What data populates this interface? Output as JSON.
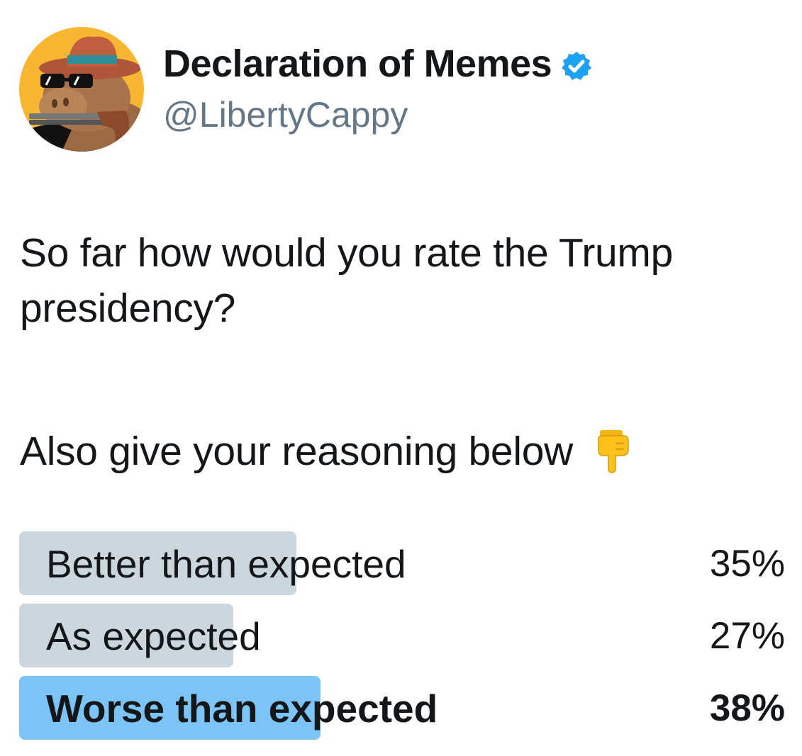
{
  "author": {
    "display_name": "Declaration of Memes",
    "handle": "@LibertyCappy",
    "verified": true,
    "avatar_icon": "capybara-cowboy-avatar",
    "verified_icon": "verified-badge-icon",
    "verified_color": "#1da1f2"
  },
  "tweet": {
    "line1": "So far how would you rate the Trump presidency?",
    "line2": "Also give your reasoning below",
    "emoji_icon": "backhand-index-pointing-down-icon"
  },
  "poll": {
    "bar_color": "#ccd6dd",
    "winner_color": "#7cc3f6",
    "options": [
      {
        "label": "Better than expected",
        "percent": "35%",
        "fraction": 0.35,
        "winner": false
      },
      {
        "label": "As expected",
        "percent": "27%",
        "fraction": 0.27,
        "winner": false
      },
      {
        "label": "Worse than expected",
        "percent": "38%",
        "fraction": 0.38,
        "winner": true
      }
    ]
  }
}
